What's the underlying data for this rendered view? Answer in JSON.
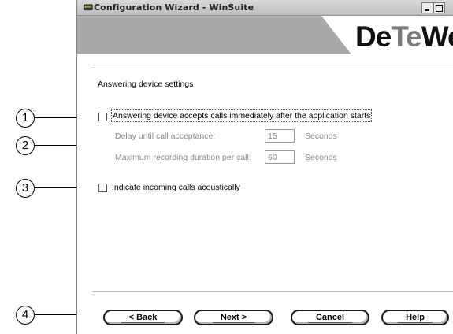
{
  "window": {
    "title": "Configuration Wizard - WinSuite",
    "brand_text": {
      "left": "De",
      "mid": "Te",
      "right": "We"
    }
  },
  "section": {
    "title": "Answering device settings"
  },
  "options": {
    "accept_calls": {
      "label": "Answering device accepts calls immediately after the application starts",
      "checked": false
    },
    "delay": {
      "label": "Delay until call acceptance:",
      "value": "15",
      "unit": "Seconds"
    },
    "max_duration": {
      "label": "Maximum recording duration per call:",
      "value": "60",
      "unit": "Seconds"
    },
    "acoustic": {
      "label": "Indicate incoming calls acoustically",
      "checked": false
    }
  },
  "buttons": {
    "back": "< Back",
    "next": "Next >",
    "cancel": "Cancel",
    "help": "Help"
  },
  "callouts": [
    "1",
    "2",
    "3",
    "4"
  ]
}
